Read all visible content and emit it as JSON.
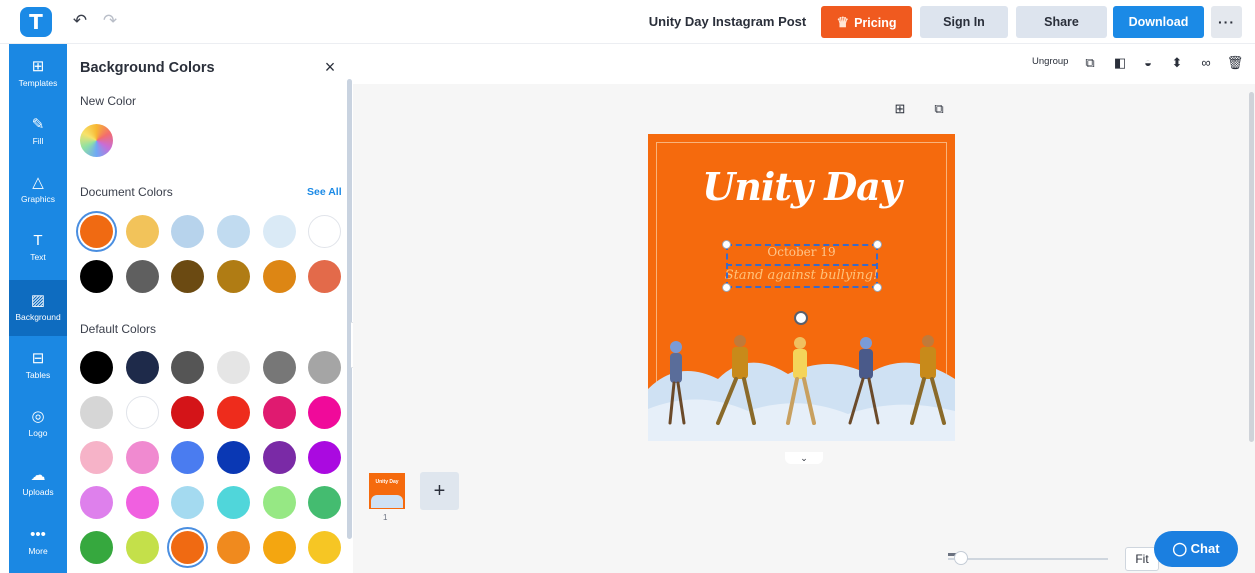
{
  "app": {
    "logo_letter": "T",
    "undo_icon": "undo-icon",
    "redo_icon": "redo-icon",
    "doc_title": "Unity Day Instagram Post",
    "pricing_label": "Pricing",
    "signin_label": "Sign In",
    "share_label": "Share",
    "download_label": "Download",
    "more_label": "···",
    "colors": {
      "accent": "#1b8ae6",
      "pricing": "#f05a1f",
      "sidebar": "#1b88e3",
      "artboard": "#f56a0d"
    }
  },
  "sidebar": {
    "items": [
      {
        "label": "Templates",
        "icon": "templates-icon",
        "glyph": "⊞"
      },
      {
        "label": "Fill",
        "icon": "fill-icon",
        "glyph": "✎"
      },
      {
        "label": "Graphics",
        "icon": "graphics-icon",
        "glyph": "△"
      },
      {
        "label": "Text",
        "icon": "text-icon",
        "glyph": "T"
      },
      {
        "label": "Background",
        "icon": "background-icon",
        "glyph": "▨",
        "active": true
      },
      {
        "label": "Tables",
        "icon": "tables-icon",
        "glyph": "⊟"
      },
      {
        "label": "Logo",
        "icon": "logo-icon",
        "glyph": "◎"
      },
      {
        "label": "Uploads",
        "icon": "uploads-icon",
        "glyph": "☁"
      },
      {
        "label": "More",
        "icon": "more-icon",
        "glyph": "•••"
      }
    ]
  },
  "panel": {
    "title": "Background Colors",
    "close_label": "×",
    "new_color_label": "New Color",
    "document_colors_label": "Document Colors",
    "see_all_label": "See All",
    "default_colors_label": "Default Colors",
    "document_colors": [
      "#f06a12",
      "#f2c35a",
      "#b7d3ec",
      "#c1dbf0",
      "#daeaf6",
      "#ffffff",
      "#000000",
      "#5f5f5f",
      "#6b4a12",
      "#b07c14",
      "#dd8614",
      "#e36a4a"
    ],
    "default_colors": [
      "#000000",
      "#1e2a4a",
      "#555555",
      "#e5e5e5",
      "#777777",
      "#a5a5a5",
      "#d6d6d6",
      "#ffffff",
      "#d41418",
      "#ee2c1c",
      "#e01a70",
      "#f00a9a",
      "#f6b3c8",
      "#f08ad0",
      "#4a7cf0",
      "#0a38b4",
      "#7a2aa6",
      "#aa0ae0",
      "#de80ec",
      "#f060e0",
      "#a4daf0",
      "#50d6da",
      "#96e884",
      "#44bc70",
      "#36a83e",
      "#c4e04a",
      "#f06a12",
      "#f08a1e",
      "#f4a610",
      "#f6c624"
    ]
  },
  "toolbar": {
    "ungroup_label": "Ungroup",
    "icons": [
      "duplicate-icon",
      "layer-icon",
      "opacity-icon",
      "align-icon",
      "link-icon",
      "delete-icon"
    ]
  },
  "canvas": {
    "title": "Unity Day",
    "date": "October 19",
    "tagline": "Stand against bullying!",
    "collapse_left": "‹",
    "collapse_bottom": "⌄"
  },
  "pages": {
    "thumb_title": "Unity Day",
    "page_number": "1",
    "add_label": "+"
  },
  "bottom": {
    "fit_label": "Fit",
    "chat_label": "Chat"
  }
}
